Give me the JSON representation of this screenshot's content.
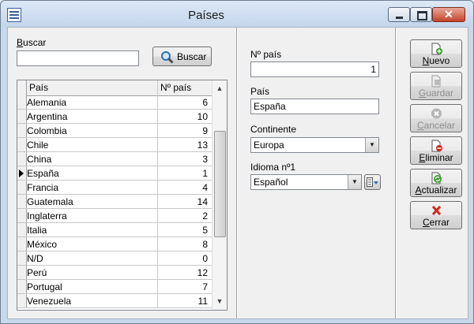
{
  "window": {
    "title": "Países"
  },
  "search": {
    "label_pre": "",
    "label_u": "B",
    "label_post": "uscar",
    "value": "",
    "button_label": "Buscar"
  },
  "grid": {
    "headers": {
      "country": "País",
      "number": "Nº país"
    },
    "rows": [
      {
        "country": "Alemania",
        "number": "6"
      },
      {
        "country": "Argentina",
        "number": "10"
      },
      {
        "country": "Colombia",
        "number": "9"
      },
      {
        "country": "Chile",
        "number": "13"
      },
      {
        "country": "China",
        "number": "3"
      },
      {
        "country": "España",
        "number": "1"
      },
      {
        "country": "Francia",
        "number": "4"
      },
      {
        "country": "Guatemala",
        "number": "14"
      },
      {
        "country": "Inglaterra",
        "number": "2"
      },
      {
        "country": "Italia",
        "number": "5"
      },
      {
        "country": "México",
        "number": "8"
      },
      {
        "country": "N/D",
        "number": "0"
      },
      {
        "country": "Perú",
        "number": "12"
      },
      {
        "country": "Portugal",
        "number": "7"
      },
      {
        "country": "Venezuela",
        "number": "11"
      }
    ]
  },
  "form": {
    "num_label": "Nº país",
    "num_value": "1",
    "country_label": "País",
    "country_value": "España",
    "continent_label": "Continente",
    "continent_value": "Europa",
    "language_label": "Idioma nº1",
    "language_value": "Español"
  },
  "actions": {
    "nuevo_u": "N",
    "nuevo_rest": "uevo",
    "guardar_u": "G",
    "guardar_rest": "uardar",
    "cancelar_u": "C",
    "cancelar_rest": "ancelar",
    "eliminar_u": "E",
    "eliminar_rest": "liminar",
    "actualizar_u": "A",
    "actualizar_rest": "ctualizar",
    "cerrar_u": "C",
    "cerrar_rest": "errar"
  },
  "colors": {
    "title_bar": "#c4d6ec",
    "close_button": "#c4432a",
    "accent_green": "#3a9a2a",
    "accent_red": "#d0281c"
  }
}
